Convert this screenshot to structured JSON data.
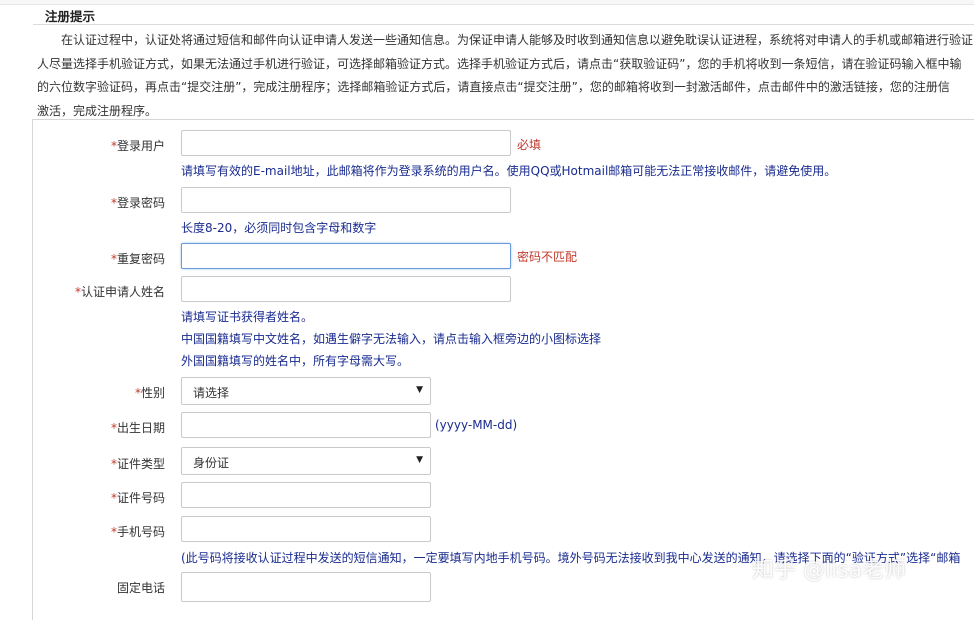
{
  "notice": {
    "title": "注册提示",
    "lines": [
      "在认证过程中，认证处将通过短信和邮件向认证申请人发送一些通知信息。为保证申请人能够及时收到通知信息以避免耽误认证进程，系统将对申请人的手机或邮箱进行验证",
      "人尽量选择手机验证方式，如果无法通过手机进行验证，可选择邮箱验证方式。选择手机验证方式后，请点击“获取验证码”，您的手机将收到一条短信，请在验证码输入框中输",
      "的六位数字验证码，再点击“提交注册”，完成注册程序；选择邮箱验证方式后，请直接点击“提交注册”，您的邮箱将收到一封激活邮件，点击邮件中的激活链接，您的注册信",
      "激活，完成注册程序。"
    ]
  },
  "form": {
    "required_mark": "*",
    "login_user": {
      "label": "登录用户",
      "status": "必填",
      "hint": "请填写有效的E-mail地址，此邮箱将作为登录系统的用户名。使用QQ或Hotmail邮箱可能无法正常接收邮件，请避免使用。"
    },
    "password": {
      "label": "登录密码",
      "hint": "长度8-20，必须同时包含字母和数字"
    },
    "repeat_password": {
      "label": "重复密码",
      "error": "密码不匹配"
    },
    "applicant_name": {
      "label": "认证申请人姓名",
      "hints": [
        "请填写证书获得者姓名。",
        "中国国籍填写中文姓名，如遇生僻字无法输入，请点击输入框旁边的小图标选择",
        "外国国籍填写的姓名中，所有字母需大写。"
      ]
    },
    "gender": {
      "label": "性别",
      "selected": "请选择"
    },
    "birth_date": {
      "label": "出生日期",
      "format": "(yyyy-MM-dd)"
    },
    "id_type": {
      "label": "证件类型",
      "selected": "身份证"
    },
    "id_number": {
      "label": "证件号码"
    },
    "mobile": {
      "label": "手机号码",
      "hint": "(此号码将接收认证过程中发送的短信通知，一定要填写内地手机号码。境外号码无法接收到我中心发送的通知，请选择下面的“验证方式”选择“邮箱"
    },
    "landline": {
      "label": "固定电话"
    }
  },
  "watermark": "知乎 @lisa老师"
}
